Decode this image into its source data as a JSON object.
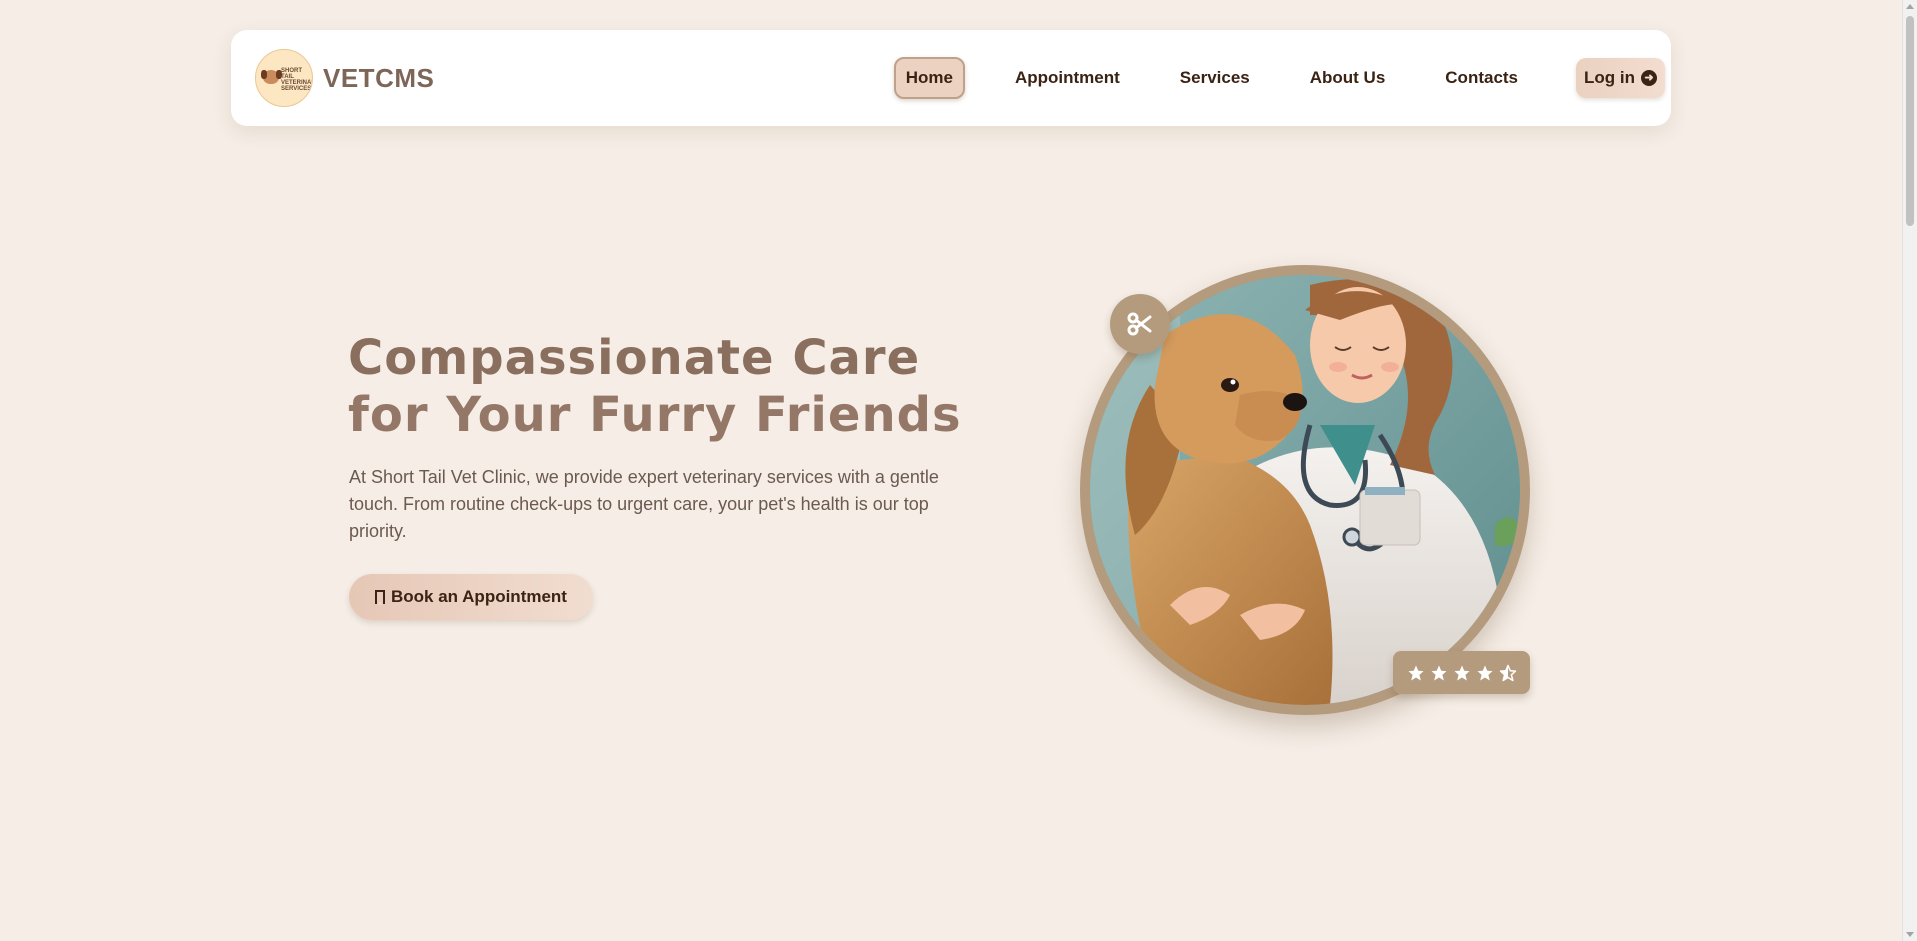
{
  "brand": {
    "name": "VETCMS",
    "logo_text": "SHORT TAIL VETERINARY SERVICES"
  },
  "nav": {
    "items": [
      {
        "label": "Home",
        "active": true
      },
      {
        "label": "Appointment",
        "active": false
      },
      {
        "label": "Services",
        "active": false
      },
      {
        "label": "About Us",
        "active": false
      },
      {
        "label": "Contacts",
        "active": false
      }
    ],
    "login_label": "Log in",
    "login_icon": "arrow-circle-right-icon"
  },
  "hero": {
    "title_line1": "Compassionate Care",
    "title_line2": "for Your Furry Friends",
    "description": "At Short Tail Vet Clinic, we provide expert veterinary services with a gentle touch. From routine check-ups to urgent care, your pet's health is our top priority.",
    "cta_label": "Book an Appointment",
    "cta_icon": "bookmark-icon",
    "badge_icon": "scissors-icon",
    "rating": 4.5,
    "rating_max": 5
  },
  "colors": {
    "background": "#f5ede6",
    "accent": "#b59b7e",
    "title": "#8a6e5e",
    "text_dark": "#3b2314"
  }
}
